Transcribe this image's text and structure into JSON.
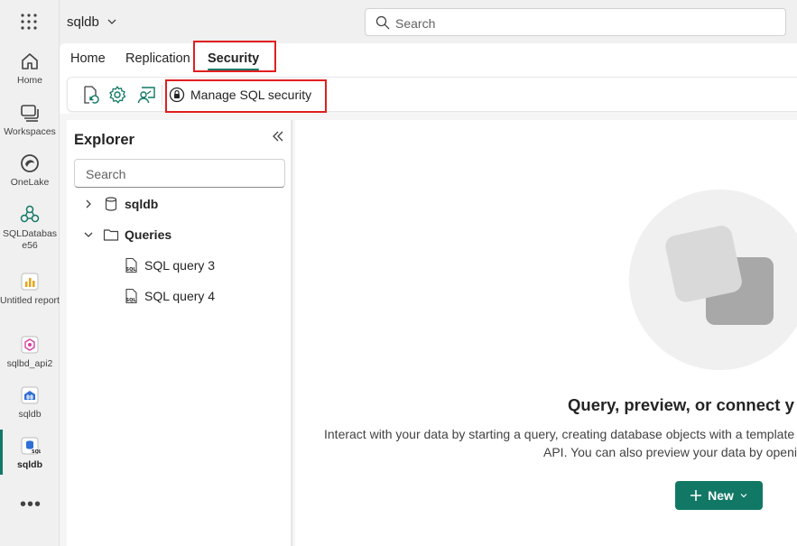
{
  "topbar": {
    "workspace_name": "sqldb",
    "search_placeholder": "Search"
  },
  "rail": {
    "items": [
      {
        "label": "Home",
        "icon": "home-icon"
      },
      {
        "label": "Workspaces",
        "icon": "workspaces-icon"
      },
      {
        "label": "OneLake",
        "icon": "onelake-icon"
      },
      {
        "label": "SQLDatabas e56",
        "icon": "sql-database-icon"
      },
      {
        "label": "Untitled report",
        "icon": "report-icon"
      },
      {
        "label": "sqlbd_api2",
        "icon": "graphql-api-icon"
      },
      {
        "label": "sqldb",
        "icon": "database-icon"
      },
      {
        "label": "sqldb",
        "icon": "sql-database-file-icon"
      }
    ],
    "more_label": "•••"
  },
  "tabs": [
    "Home",
    "Replication",
    "Security"
  ],
  "active_tab": "Security",
  "ribbon": {
    "manage_security_label": "Manage SQL security"
  },
  "explorer": {
    "title": "Explorer",
    "search_placeholder": "Search",
    "tree": {
      "db_name": "sqldb",
      "queries_label": "Queries",
      "queries": [
        "SQL query 3",
        "SQL query 4"
      ]
    }
  },
  "empty_state": {
    "title": "Query, preview, or connect y",
    "desc_line1": "Interact with your data by starting a query, creating database objects with a template",
    "desc_line2": "API. You can also preview your data by openir",
    "new_button": "New"
  },
  "colors": {
    "accent": "#117865",
    "highlight": "#e02020"
  }
}
